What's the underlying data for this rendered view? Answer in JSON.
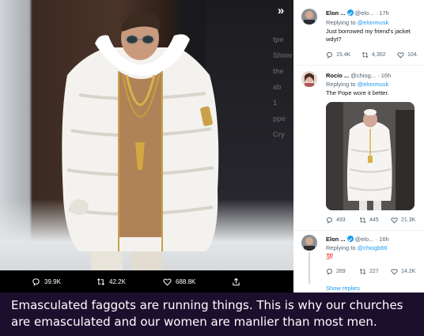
{
  "photo": {
    "overlay_fragments": [
      "tpe",
      "Show",
      "the",
      "ab",
      "1",
      "ppe",
      "Cry"
    ],
    "actions": {
      "replies": "39.9K",
      "retweets": "42.2K",
      "likes": "688.8K"
    },
    "icons": [
      "expand-icon",
      "reply-icon",
      "retweet-icon",
      "like-icon",
      "share-icon"
    ]
  },
  "thread": {
    "tweets": [
      {
        "name": "Elon ...",
        "handle": "@elo...",
        "time": "· 17h",
        "replying_label": "Replying to",
        "replying_handle": "@elonmusk",
        "text": "Just borrowed my friend's jacket wdyt?",
        "stats": {
          "replies": "15.4K",
          "retweets": "4,302",
          "likes": "104."
        }
      },
      {
        "name": "Rocío ...",
        "handle": "@chiog...",
        "time": "· 16h",
        "replying_label": "Replying to",
        "replying_handle": "@elonmusk",
        "text": "The Pope wore it better.",
        "stats": {
          "replies": "493",
          "retweets": "445",
          "likes": "21.3K"
        }
      },
      {
        "name": "Elon ...",
        "handle": "@elo...",
        "time": "· 16h",
        "replying_label": "Replying to",
        "replying_handle": "@chiogb66",
        "text": "💯",
        "stats": {
          "replies": "269",
          "retweets": "227",
          "likes": "14.2K"
        }
      }
    ],
    "show_replies": "Show replies"
  },
  "caption": {
    "text": "Emasculated faggots are running things. This is why our churches are emasculated and our women are manlier than most men."
  },
  "colors": {
    "accent": "#1d9bf0",
    "caption_bg": "#1c0f2e",
    "muted_text": "#536471"
  }
}
